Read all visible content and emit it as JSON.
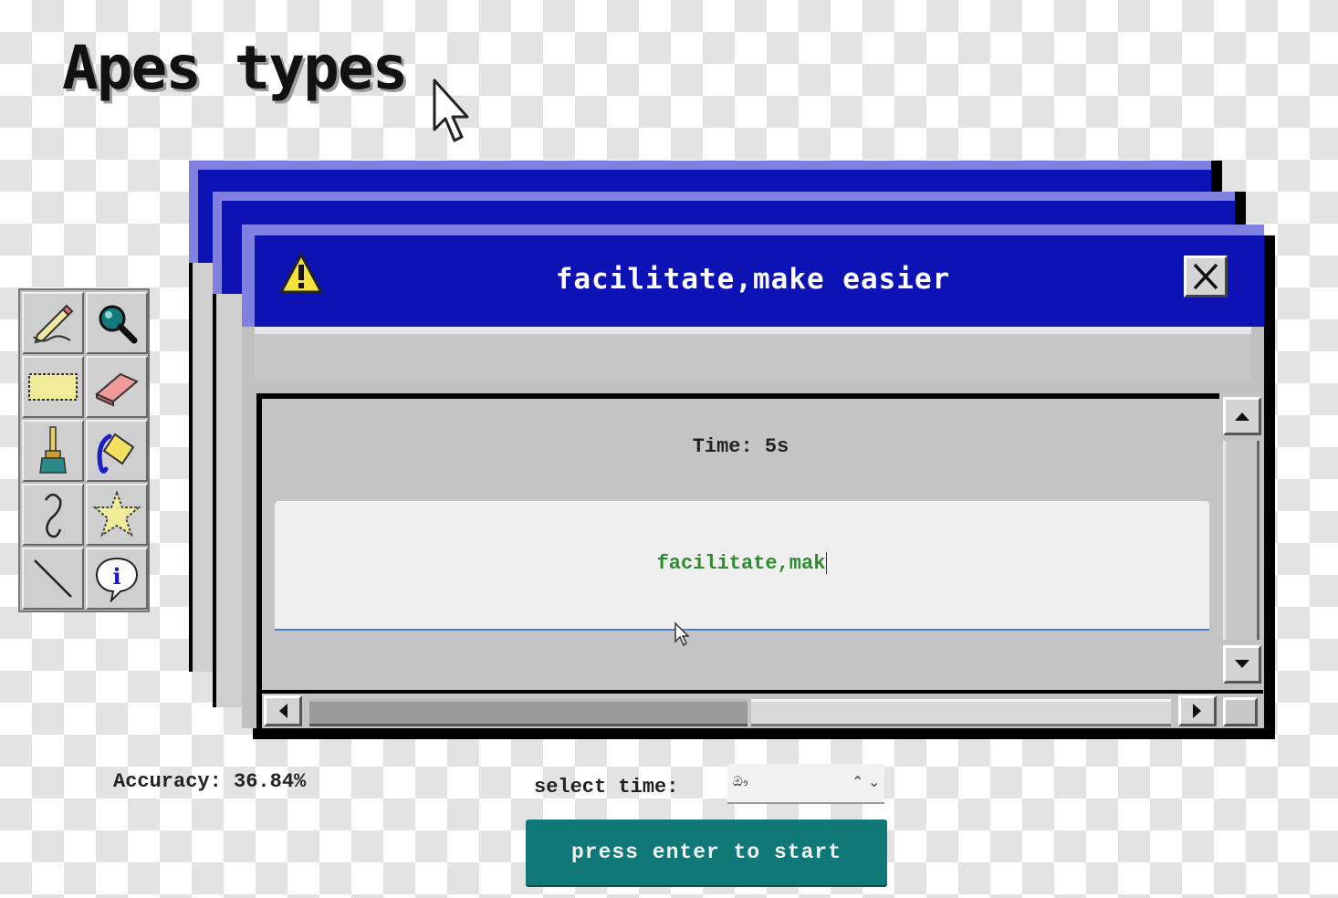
{
  "app": {
    "title": "Apes types"
  },
  "dialog": {
    "title": "facilitate,make easier",
    "timer_text": "Time: 5s",
    "typed_text": "facilitate,mak"
  },
  "footer": {
    "accuracy_text": "Accuracy: 36.84%",
    "select_time_label": "select time:",
    "select_time_value": "ඖ",
    "start_button_label": "press enter to start"
  },
  "icons": {
    "dialog": "warning-icon",
    "close": "close-icon",
    "tools": [
      "pencil-icon",
      "magnifier-icon",
      "rectangle-select-icon",
      "eraser-icon",
      "brush-icon",
      "fill-bucket-icon",
      "curve-icon",
      "free-select-icon",
      "line-icon",
      "info-icon"
    ]
  },
  "colors": {
    "titlebar": "#0d12b5",
    "titlebar_highlight": "#8080e0",
    "typed_text": "#2f8a2f",
    "start_button": "#117878"
  }
}
